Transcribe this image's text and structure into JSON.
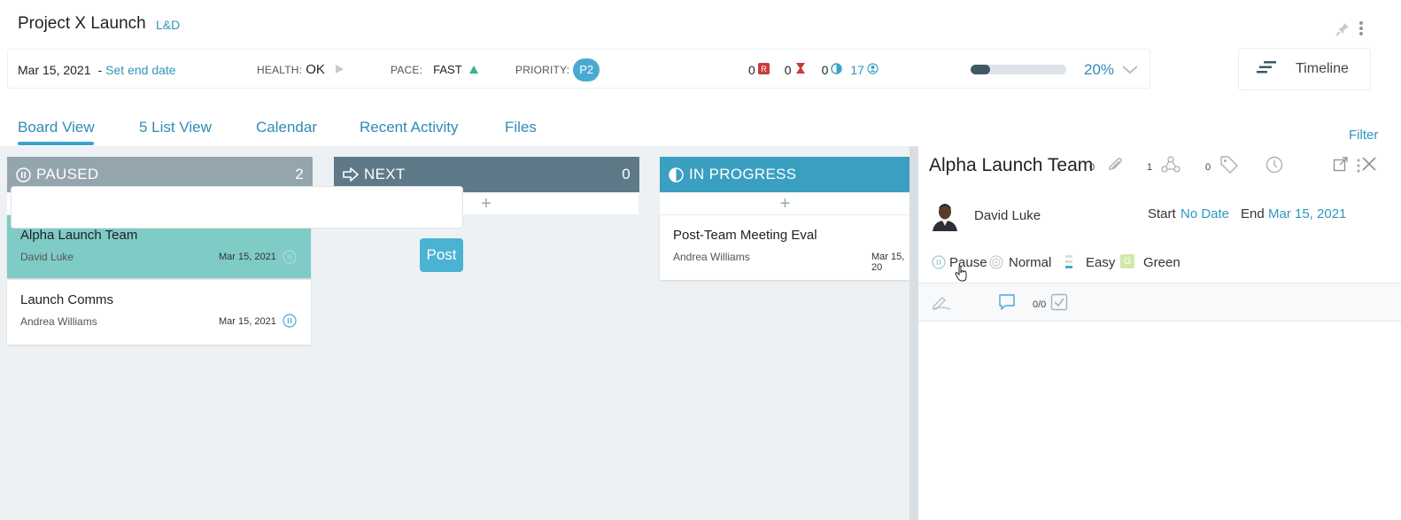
{
  "header": {
    "project_title": "Project X Launch",
    "project_tag": "L&D"
  },
  "status_bar": {
    "start_date": "Mar 15, 2021",
    "end_date_link": "Set end date",
    "health_label": "HEALTH:",
    "health_value": "OK",
    "pace_label": "PACE:",
    "pace_value": "FAST",
    "priority_label": "PRIORITY:",
    "priority_value": "P2",
    "counters": [
      {
        "value": "0",
        "icon": "r-badge-icon"
      },
      {
        "value": "0",
        "icon": "hourglass-icon"
      },
      {
        "value": "0",
        "icon": "half-circle-icon"
      },
      {
        "value": "17",
        "icon": "user-icon"
      }
    ],
    "progress_fraction": 0.2,
    "progress_text": "20%"
  },
  "timeline_button": {
    "label": "Timeline"
  },
  "tabs": [
    {
      "label": "Board View",
      "active": true
    },
    {
      "label": "5 List View"
    },
    {
      "label": "Calendar"
    },
    {
      "label": "Recent Activity"
    },
    {
      "label": "Files"
    }
  ],
  "filter_label": "Filter",
  "columns": [
    {
      "name": "PAUSED",
      "count": "2",
      "color": "#95a5ae",
      "cards": [
        {
          "title": "Alpha Launch Team",
          "owner": "David Luke",
          "date": "Mar 15, 2021",
          "selected": true
        },
        {
          "title": "Launch Comms",
          "owner": "Andrea Williams",
          "date": "Mar 15, 2021"
        }
      ]
    },
    {
      "name": "NEXT",
      "count": "0",
      "color": "#5e7a88",
      "cards": []
    },
    {
      "name": "IN PROGRESS",
      "count": "",
      "color": "#3a9fc0",
      "cards": [
        {
          "title": "Post-Team Meeting Eval",
          "owner": "Andrea Williams",
          "date": "Mar 15, 20"
        }
      ]
    }
  ],
  "detail": {
    "title": "Alpha Launch Team",
    "owner": "David Luke",
    "start_label": "Start",
    "start_value": "No Date",
    "end_label": "End",
    "end_value": "Mar 15, 2021",
    "status": "Pause",
    "priority": "Normal",
    "effort": "Easy",
    "health_badge": "G",
    "health": "Green",
    "toolbar_counts": {
      "checklist": "0/0",
      "attachments": "0",
      "links": "1",
      "tags": "0"
    },
    "comment_placeholder": "",
    "post_label": "Post"
  },
  "colors": {
    "accent": "#2e97bd",
    "selected_card": "#7fcbc5",
    "board_bg": "#edf1f4"
  }
}
